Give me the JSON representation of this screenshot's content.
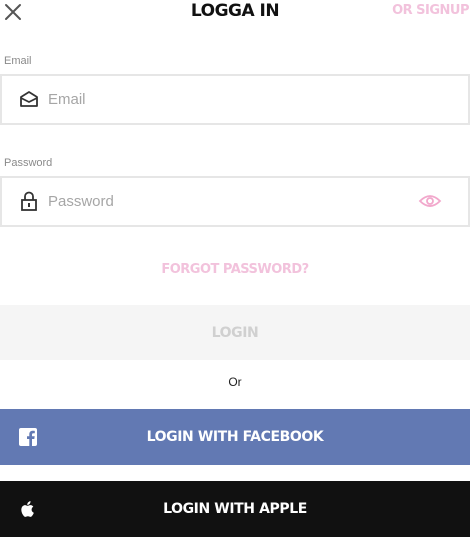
{
  "header": {
    "close_icon": "close-icon",
    "title": "LOGGA IN",
    "signup_label": "OR SIGNUP"
  },
  "email": {
    "label": "Email",
    "placeholder": "Email",
    "value": "",
    "icon": "envelope-icon"
  },
  "password": {
    "label": "Password",
    "placeholder": "Password",
    "value": "",
    "icon": "lock-icon",
    "toggle_icon": "eye-icon"
  },
  "forgot_label": "FORGOT PASSWORD?",
  "login_label": "LOGIN",
  "divider_text": "Or",
  "facebook": {
    "label": "LOGIN WITH FACEBOOK",
    "icon": "facebook-icon"
  },
  "apple": {
    "label": "LOGIN WITH APPLE",
    "icon": "apple-icon"
  },
  "colors": {
    "accent_pink": "#f2c2dc",
    "facebook_blue": "#6279b3",
    "apple_black": "#111111",
    "login_disabled_bg": "#f5f5f5",
    "login_disabled_text": "#d0d0d0"
  }
}
